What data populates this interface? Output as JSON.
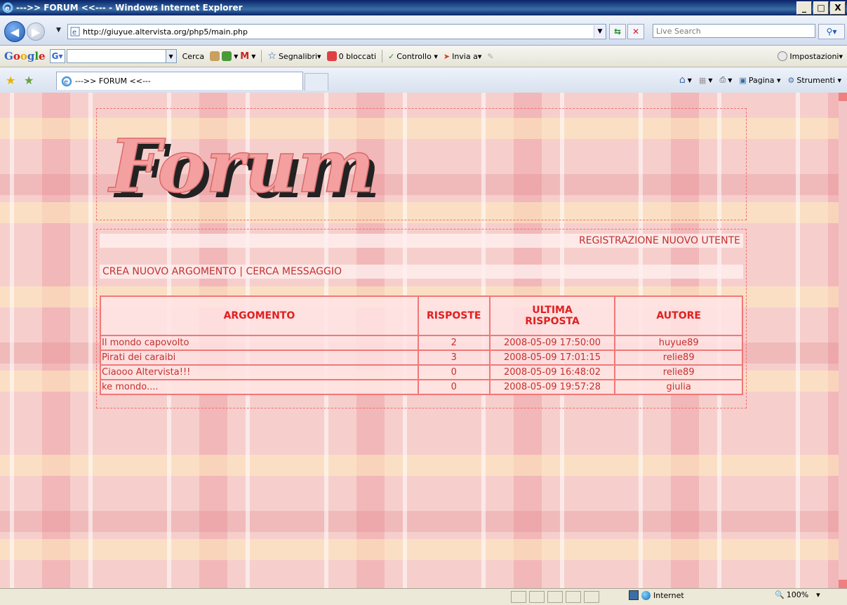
{
  "window": {
    "title": "--->> FORUM <<--- - Windows Internet Explorer",
    "min_label": "_",
    "max_label": "□",
    "close_label": "X"
  },
  "address": {
    "url": "http://giuyue.altervista.org/php5/main.php",
    "search_placeholder": "Live Search"
  },
  "google_toolbar": {
    "logo": [
      "G",
      "o",
      "o",
      "g",
      "l",
      "e"
    ],
    "g_label": "G▾",
    "search_label": "Cerca",
    "bookmarks_label": "Segnalibri▾",
    "blocked_label": "0 bloccati",
    "check_label": "Controllo ▾",
    "send_label": "Invia a▾",
    "settings_label": "Impostazioni▾"
  },
  "tabs": {
    "active_tab_label": "--->> FORUM <<---",
    "page_menu": "Pagina ▾",
    "tools_menu": "Strumenti ▾"
  },
  "forum": {
    "logo_text": "Forum",
    "register_link": "REGISTRAZIONE NUOVO UTENTE",
    "new_topic_link": "CREA NUOVO ARGOMENTO",
    "menu_separator": " | ",
    "search_link": "CERCA MESSAGGIO",
    "columns": {
      "topic": "ARGOMENTO",
      "replies": "RISPOSTE",
      "last_reply_1": "ULTIMA",
      "last_reply_2": "RISPOSTA",
      "author": "AUTORE"
    },
    "rows": [
      {
        "topic": "Il mondo capovolto",
        "replies": "2",
        "last": "2008-05-09 17:50:00",
        "author": "huyue89"
      },
      {
        "topic": "Pirati dei caraibi",
        "replies": "3",
        "last": "2008-05-09 17:01:15",
        "author": "relie89"
      },
      {
        "topic": "Ciaooo Altervista!!!",
        "replies": "0",
        "last": "2008-05-09 16:48:02",
        "author": "relie89"
      },
      {
        "topic": "ke mondo....",
        "replies": "0",
        "last": "2008-05-09 19:57:28",
        "author": "giulia"
      }
    ]
  },
  "status": {
    "zone": "Internet",
    "zoom": "100%",
    "zoom_dd": "▾"
  },
  "colors": {
    "accent": "#c43030",
    "logo_fill": "#f4a0a0",
    "logo_shadow": "#222222"
  }
}
